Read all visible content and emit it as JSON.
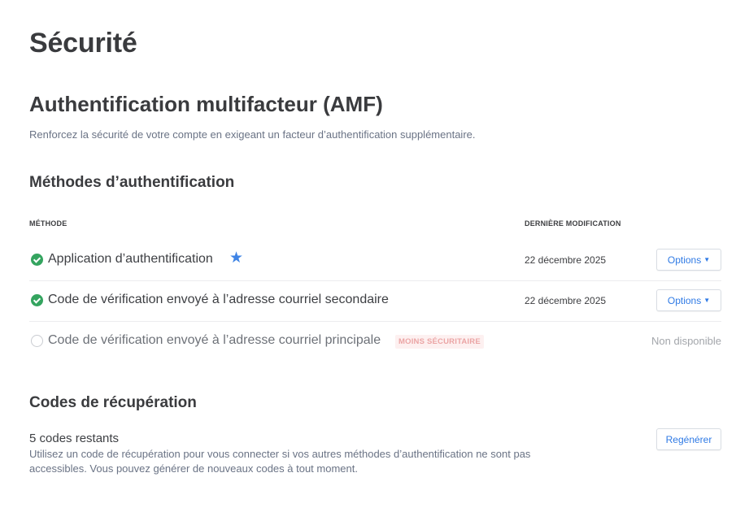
{
  "page": {
    "title": "Sécurité"
  },
  "mfa": {
    "title": "Authentification multifacteur (AMF)",
    "description": "Renforcez la sécurité de votre compte en exigeant un facteur d’authentification supplémentaire."
  },
  "methods": {
    "title": "Méthodes d’authentification",
    "col_method": "MÉTHODE",
    "col_modified": "DERNIÈRE MODIFICATION",
    "rows": [
      {
        "label": "Application d’authentification",
        "status": "enabled",
        "starred": true,
        "date": "22 décembre 2025",
        "action": "Options"
      },
      {
        "label": "Code de vérification envoyé à l’adresse courriel secondaire",
        "status": "enabled",
        "date": "22 décembre 2025",
        "action": "Options"
      },
      {
        "label": "Code de vérification envoyé à l’adresse courriel principale",
        "status": "disabled",
        "badge": "MOINS SÉCURITAIRE",
        "availability": "Non disponible"
      }
    ]
  },
  "recovery": {
    "title": "Codes de récupération",
    "count": "5 codes restants",
    "description": "Utilisez un code de récupération pour vous connecter si vos autres méthodes d’authentification ne sont pas accessibles. Vous pouvez générer de nouveaux codes à tout moment.",
    "action": "Regénérer"
  },
  "colors": {
    "accent": "#2f7ae5",
    "success": "#34a45f",
    "star": "#3f84e5",
    "badge_text": "#eba5a5"
  },
  "icons": {
    "enabled": "check-circle-icon",
    "disabled": "empty-circle-icon",
    "favorite": "star-icon",
    "dropdown": "chevron-down-icon"
  }
}
